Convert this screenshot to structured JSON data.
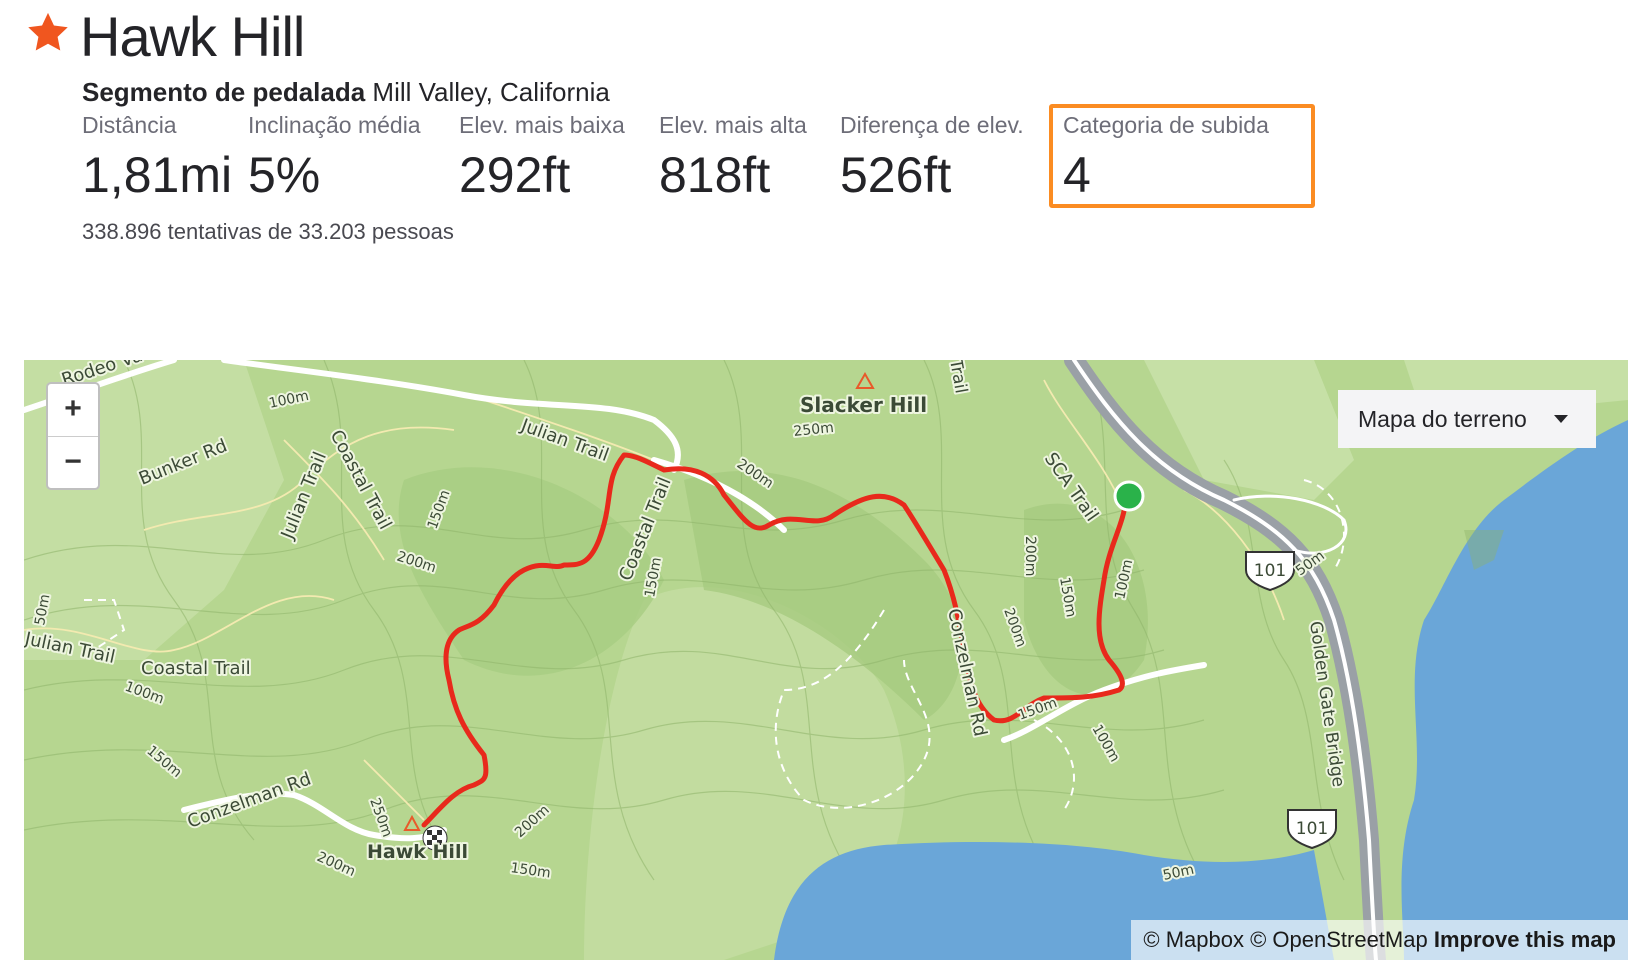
{
  "segment": {
    "title": "Hawk Hill",
    "type_label": "Segmento de pedalada",
    "location": "Mill Valley, California",
    "attempts": "338.896 tentativas de 33.203 pessoas",
    "accent_color": "#fc5200",
    "highlight_color": "#fb8c22"
  },
  "stats": [
    {
      "label": "Distância",
      "value": "1,81mi"
    },
    {
      "label": "Inclinação média",
      "value": "5%"
    },
    {
      "label": "Elev. mais baixa",
      "value": "292ft"
    },
    {
      "label": "Elev. mais alta",
      "value": "818ft"
    },
    {
      "label": "Diferença de elev.",
      "value": "526ft"
    },
    {
      "label": "Categoria de subida",
      "value": "4"
    }
  ],
  "map": {
    "zoom_in": "+",
    "zoom_out": "−",
    "map_type": "Mapa do terreno",
    "attribution_prefix": "© Mapbox © OpenStreetMap",
    "attribution_link": "Improve this map",
    "labels": {
      "slacker_hill": "Slacker Hill",
      "hawk_hill": "Hawk Hill",
      "julian_trail_1": "Julian Trail",
      "julian_trail_2": "Julian Trail",
      "julian_trail_3": "Julian Trail",
      "coastal_trail_1": "Coastal Trail",
      "coastal_trail_2": "Coastal Trail",
      "coastal_trail_3": "Coastal Trail",
      "bunker_rd": "Bunker Rd",
      "rodeo_valley": "Rodeo Va",
      "conzelman_rd_1": "Conzelman Rd",
      "conzelman_rd_2": "Conzelman Rd",
      "sca_trail": "SCA Trail",
      "golden_gate_bridge": "Golden Gate Bridge",
      "highway_1": "101",
      "highway_2": "101",
      "alexander": "Trail",
      "c100a": "100m",
      "c100b": "100m",
      "c100c": "100m",
      "c100d": "100m",
      "c150a": "150m",
      "c150b": "150m",
      "c150c": "150m",
      "c150d": "150m",
      "c150e": "150m",
      "c150f": "150m",
      "c200a": "200m",
      "c200b": "200m",
      "c200c": "200m",
      "c200d": "200m",
      "c200e": "200m",
      "c200f": "200m",
      "c250a": "250m",
      "c250b": "250m",
      "c50a": "50m",
      "c50b": "50m",
      "c50c": "50m"
    },
    "colors": {
      "land": "#b6d690",
      "water": "#6aa6d8",
      "route": "#e8291c",
      "start": "#2ab24a",
      "road": "#ffffff",
      "highway": "#9aa0a6"
    }
  }
}
